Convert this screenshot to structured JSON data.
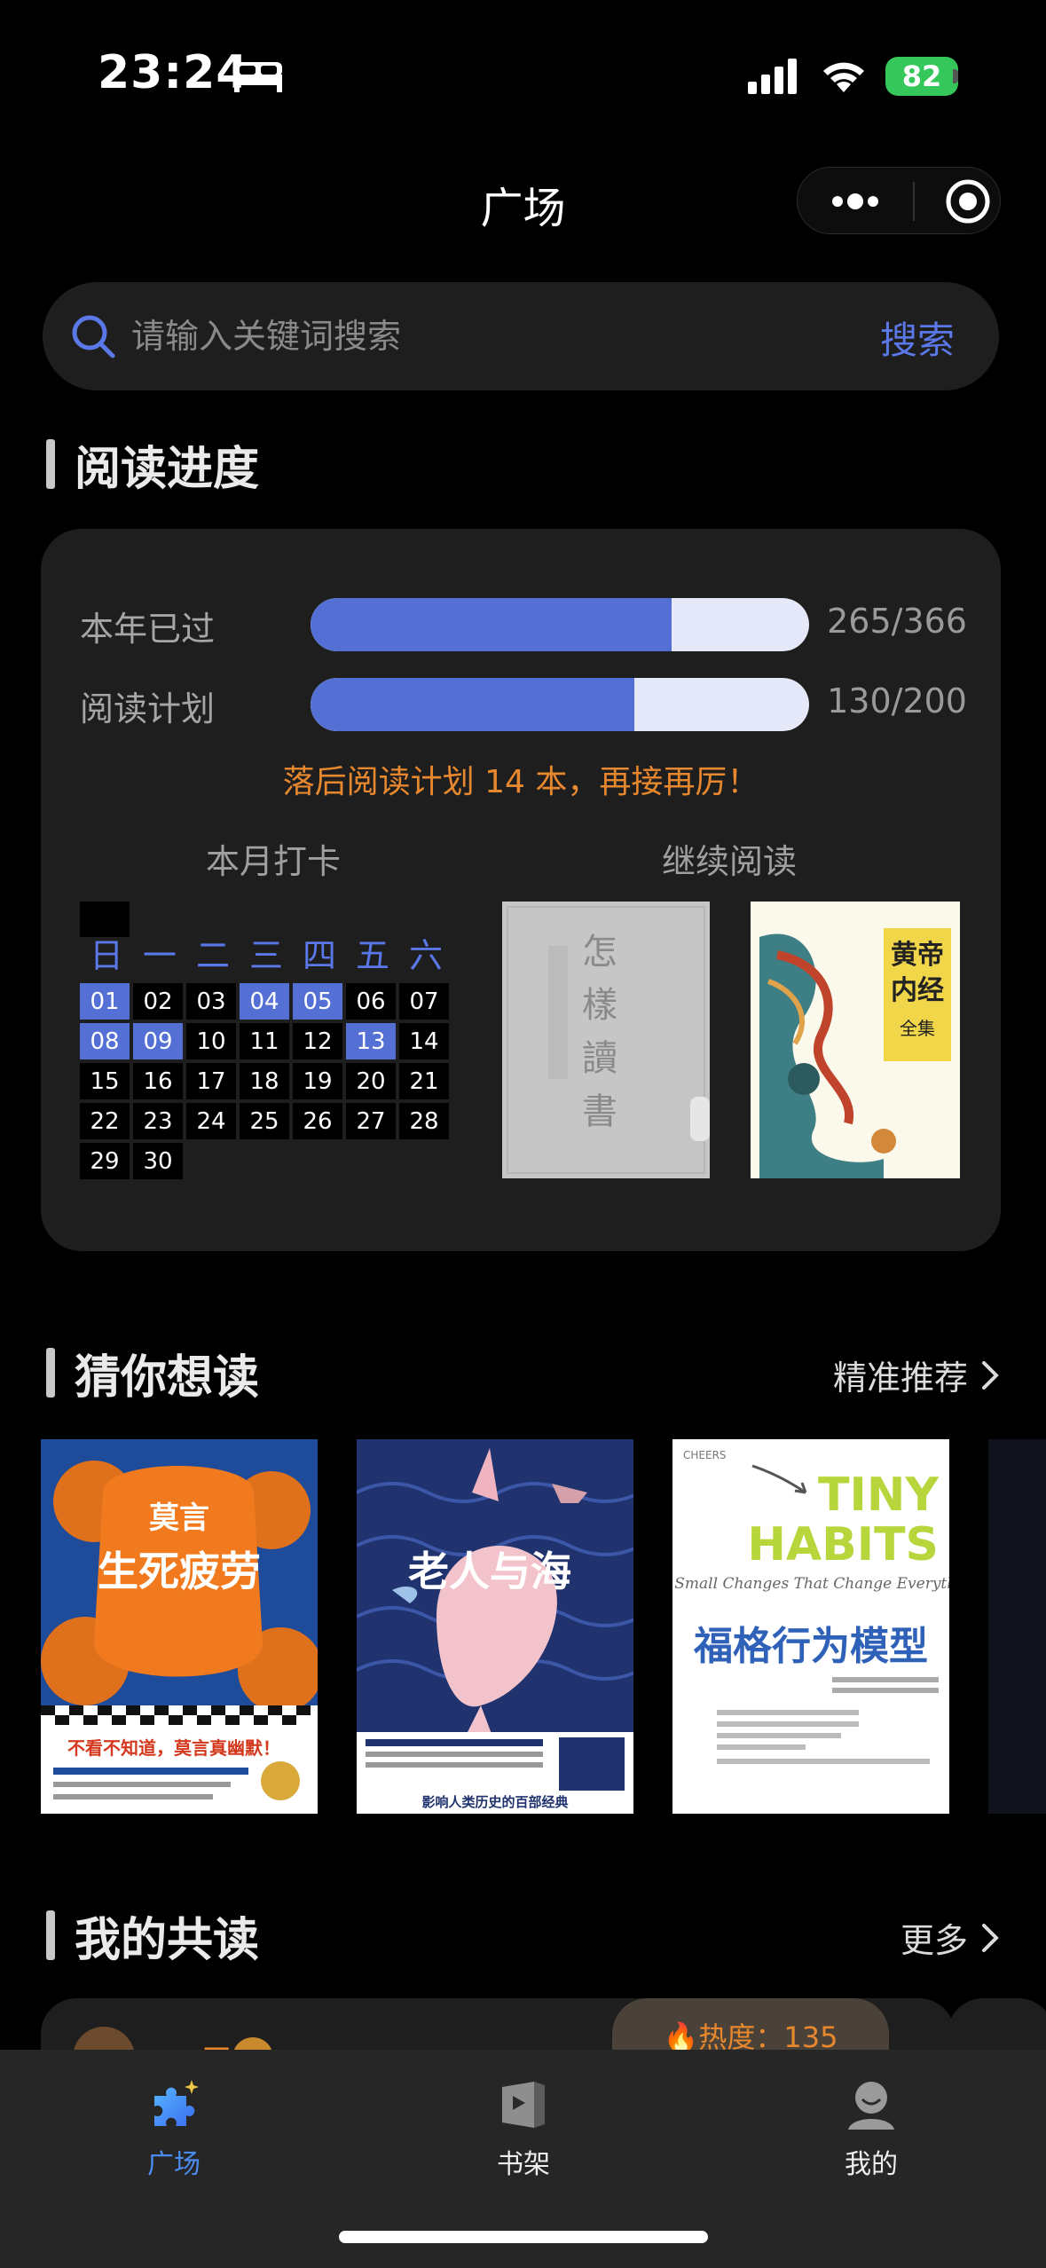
{
  "status_bar": {
    "time": "23:24",
    "battery": "82",
    "icons": [
      "bed-icon",
      "signal-icon",
      "wifi-icon",
      "battery-icon"
    ]
  },
  "nav": {
    "title": "广场",
    "more_icon": "more-dots-icon",
    "close_icon": "target-icon"
  },
  "search": {
    "placeholder": "请输入关键词搜索",
    "button_label": "搜索"
  },
  "progress": {
    "section_title": "阅读进度",
    "rows": [
      {
        "label": "本年已过",
        "value_text": "265/366",
        "fraction": 0.724
      },
      {
        "label": "阅读计划",
        "value_text": "130/200",
        "fraction": 0.65
      }
    ],
    "warning": "落后阅读计划 14 本，再接再厉！",
    "checkin_title": "本月打卡",
    "continue_title": "继续阅读",
    "weekdays": [
      "日",
      "一",
      "二",
      "三",
      "四",
      "五",
      "六"
    ],
    "days": [
      "01",
      "02",
      "03",
      "04",
      "05",
      "06",
      "07",
      "08",
      "09",
      "10",
      "11",
      "12",
      "13",
      "14",
      "15",
      "16",
      "17",
      "18",
      "19",
      "20",
      "21",
      "22",
      "23",
      "24",
      "25",
      "26",
      "27",
      "28",
      "29",
      "30"
    ],
    "checked_days": [
      "01",
      "04",
      "05",
      "08",
      "09",
      "13"
    ],
    "continue_books": [
      {
        "cover_text": "怎樣讀書"
      },
      {
        "cover_text": "黄帝内经"
      }
    ]
  },
  "recommend": {
    "section_title": "猜你想读",
    "more_label": "精准推荐",
    "books": [
      {
        "title": "生死疲劳",
        "author": "莫言",
        "tagline": "不看不知道，莫言真幽默！"
      },
      {
        "title": "老人与海",
        "tagline": "影响人类历史的百部经典"
      },
      {
        "title": "福格行为模型",
        "headline": "TINY HABITS",
        "subhead": "The Small Changes That Change Everything"
      }
    ]
  },
  "coread": {
    "section_title": "我的共读",
    "more_label": "更多",
    "heat_label": "🔥热度：135",
    "name": "云泽"
  },
  "tabs": [
    {
      "label": "广场",
      "icon": "puzzle-icon",
      "active": true
    },
    {
      "label": "书架",
      "icon": "bookshelf-icon",
      "active": false
    },
    {
      "label": "我的",
      "icon": "profile-icon",
      "active": false
    }
  ],
  "colors": {
    "accent": "#5470d4",
    "warning": "#e8882e",
    "tab_active": "#4b8cf0",
    "card": "#1e1e1e"
  }
}
